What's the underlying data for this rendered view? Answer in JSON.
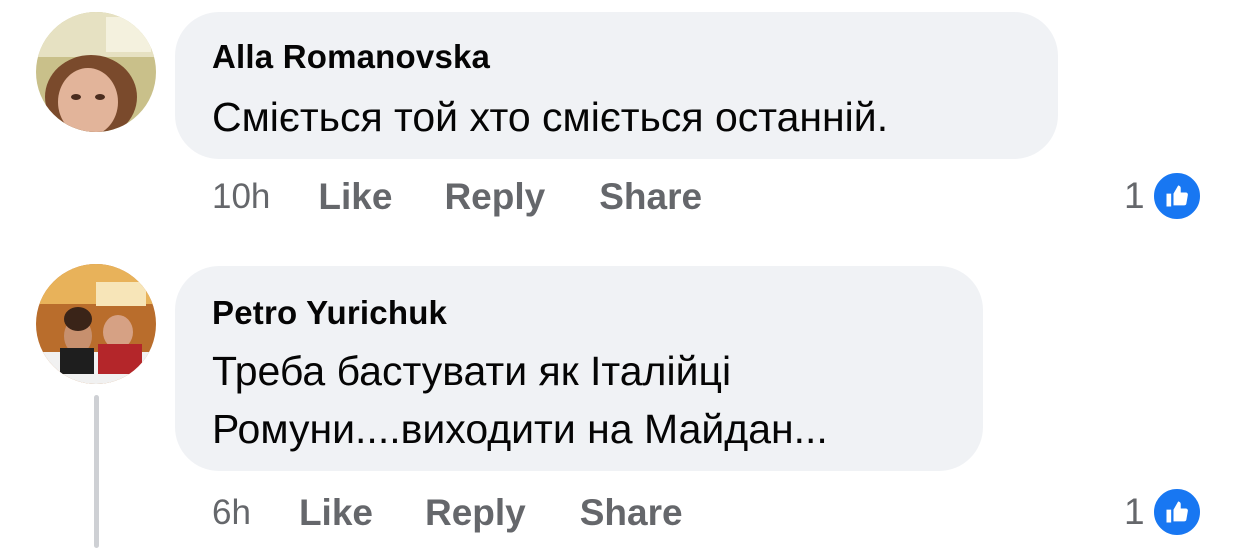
{
  "comments": [
    {
      "author": "Alla Romanovska",
      "text": "Сміється той хто сміється останній.",
      "time": "10h",
      "actions": [
        "Like",
        "Reply",
        "Share"
      ],
      "reaction_count": "1",
      "reaction_icon": "like-icon"
    },
    {
      "author": "Petro Yurichuk",
      "text": "Треба бастувати як Італійці\nРомуни....виходити на Майдан...",
      "time": "6h",
      "actions": [
        "Like",
        "Reply",
        "Share"
      ],
      "reaction_count": "1",
      "reaction_icon": "like-icon"
    }
  ],
  "colors": {
    "bubble": "#f0f2f5",
    "meta_text": "#65676b",
    "like_blue": "#1877f2"
  }
}
